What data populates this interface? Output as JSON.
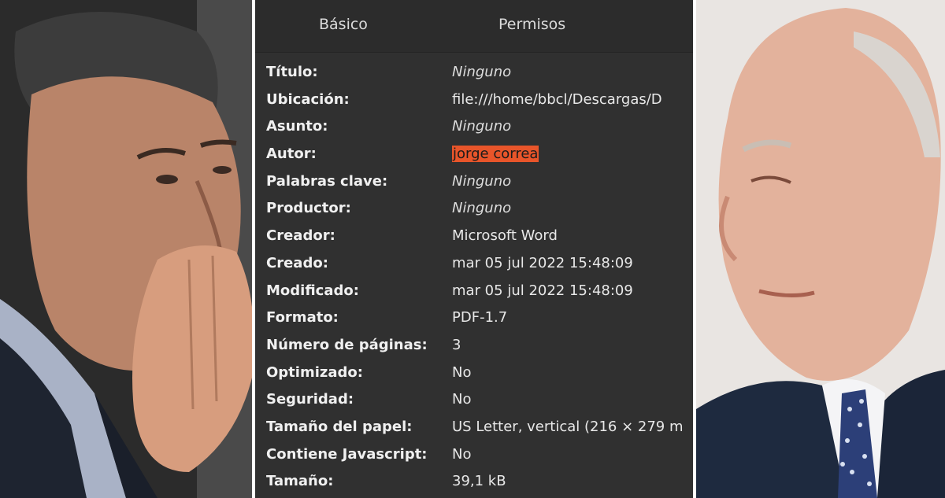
{
  "tabs": {
    "basic": "Básico",
    "permissions": "Permisos"
  },
  "properties": [
    {
      "label": "Título:",
      "value": "Ninguno",
      "style": "italic"
    },
    {
      "label": "Ubicación:",
      "value": "file:///home/bbcl/Descargas/D",
      "style": "normal"
    },
    {
      "label": "Asunto:",
      "value": "Ninguno",
      "style": "italic"
    },
    {
      "label": "Autor:",
      "value": "jorge correa",
      "style": "highlight"
    },
    {
      "label": "Palabras clave:",
      "value": "Ninguno",
      "style": "italic"
    },
    {
      "label": "Productor:",
      "value": "Ninguno",
      "style": "italic"
    },
    {
      "label": "Creador:",
      "value": "Microsoft Word",
      "style": "normal"
    },
    {
      "label": "Creado:",
      "value": "mar 05 jul 2022 15:48:09",
      "style": "normal"
    },
    {
      "label": "Modificado:",
      "value": "mar 05 jul 2022 15:48:09",
      "style": "normal"
    },
    {
      "label": "Formato:",
      "value": "PDF-1.7",
      "style": "normal"
    },
    {
      "label": "Número de páginas:",
      "value": "3",
      "style": "normal"
    },
    {
      "label": "Optimizado:",
      "value": "No",
      "style": "normal"
    },
    {
      "label": "Seguridad:",
      "value": "No",
      "style": "normal"
    },
    {
      "label": "Tamaño del papel:",
      "value": "US Letter, vertical (216 × 279 m",
      "style": "normal"
    },
    {
      "label": "Contiene Javascript:",
      "value": "No",
      "style": "normal"
    },
    {
      "label": "Tamaño:",
      "value": "39,1 kB",
      "style": "normal"
    }
  ],
  "colors": {
    "dialog_bg": "#303030",
    "highlight": "#e8552a"
  }
}
